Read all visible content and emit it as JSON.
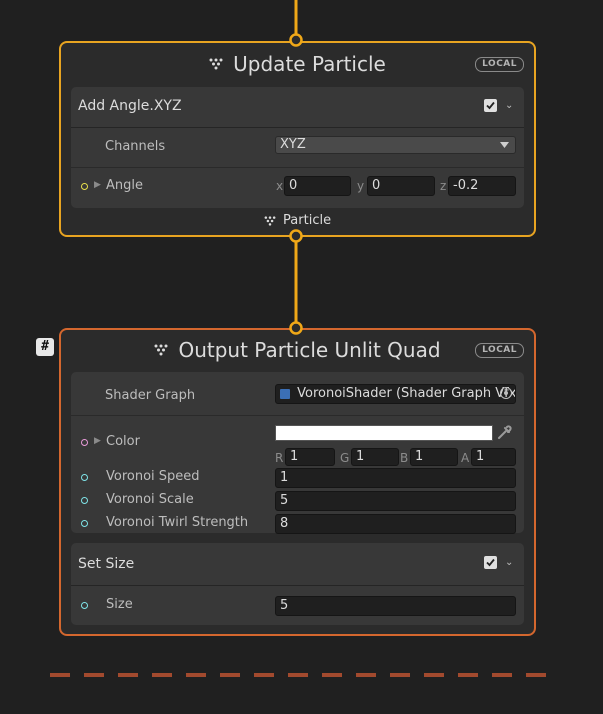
{
  "update_particle": {
    "title": "Update Particle",
    "badge": "LOCAL",
    "block": {
      "title": "Add Angle.XYZ",
      "enabled": true,
      "channels_label": "Channels",
      "channels_value": "XYZ",
      "angle_label": "Angle",
      "x_label": "x",
      "x_value": "0",
      "y_label": "y",
      "y_value": "0",
      "z_label": "z",
      "z_value": "-0.2"
    },
    "footer_label": "Particle"
  },
  "output_particle": {
    "title": "Output Particle Unlit Quad",
    "badge": "LOCAL",
    "shader_graph_label": "Shader Graph",
    "shader_graph_value": "VoronoiShader (Shader Graph Vfx",
    "color_label": "Color",
    "color_value": "#ffffff",
    "r_label": "R",
    "r_value": "1",
    "g_label": "G",
    "g_value": "1",
    "b_label": "B",
    "b_value": "1",
    "a_label": "A",
    "a_value": "1",
    "voronoi_speed_label": "Voronoi Speed",
    "voronoi_speed_value": "1",
    "voronoi_scale_label": "Voronoi Scale",
    "voronoi_scale_value": "5",
    "voronoi_twirl_label": "Voronoi Twirl Strength",
    "voronoi_twirl_value": "8",
    "set_size": {
      "title": "Set Size",
      "enabled": true,
      "size_label": "Size",
      "size_value": "5"
    }
  },
  "system_badge": "#",
  "colors": {
    "update_border": "#e8a421",
    "output_border": "#d4672e",
    "flow_line": "#f0a818",
    "annotation": "#f5e614",
    "port_yellow": "#e8e04c",
    "port_pink": "#e89ad8",
    "port_cyan": "#7fe4e8"
  }
}
